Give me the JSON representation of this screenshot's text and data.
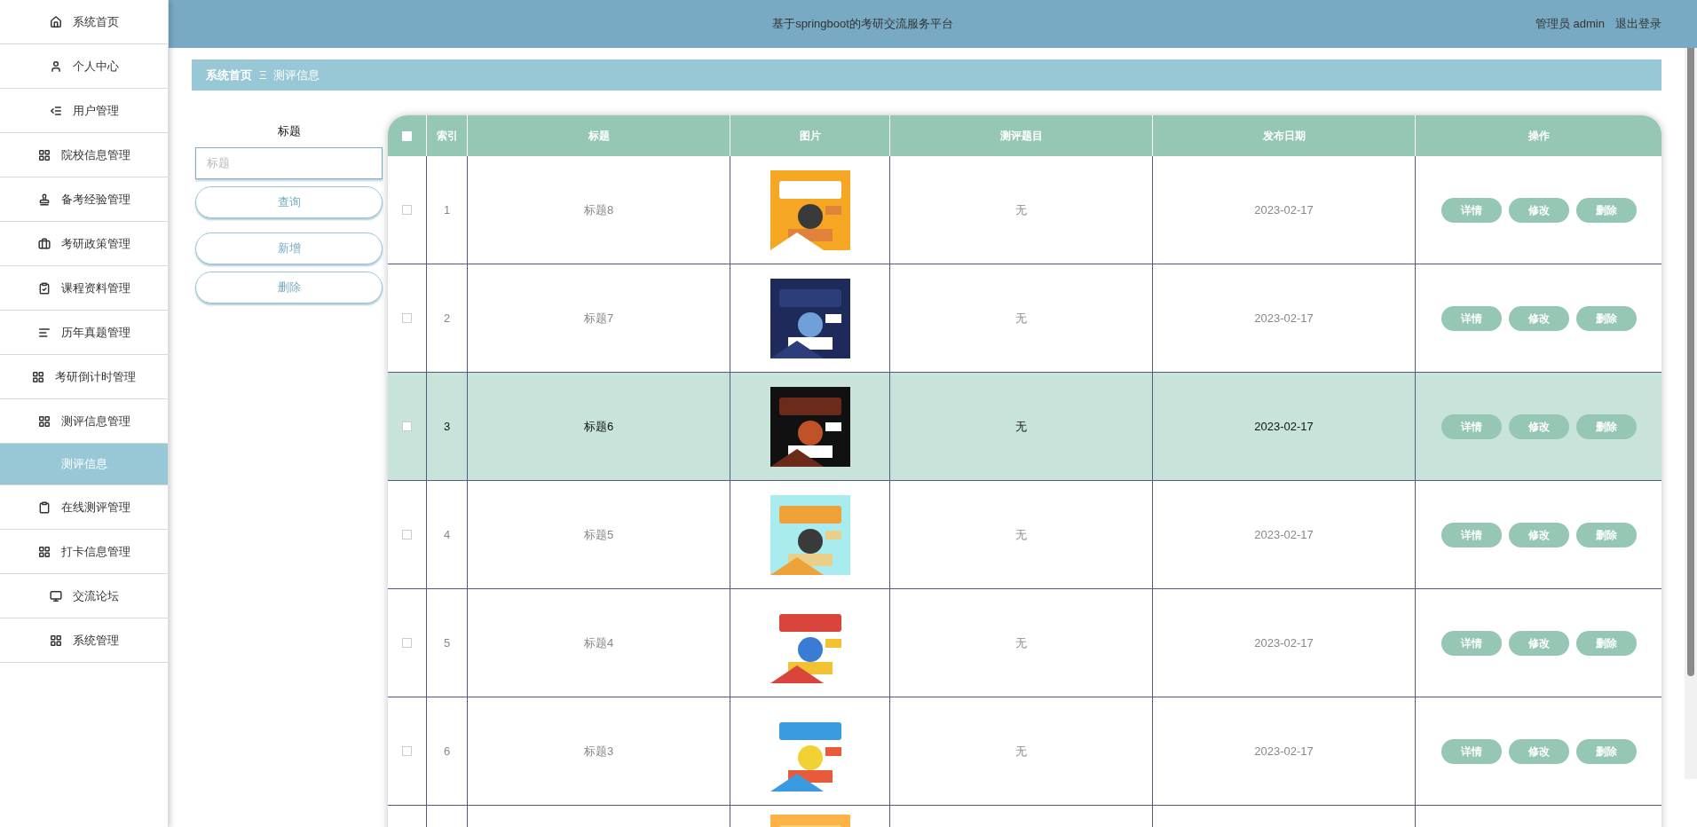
{
  "sidebar": {
    "items": [
      {
        "label": "系统首页",
        "selected": false
      },
      {
        "label": "个人中心",
        "selected": false
      },
      {
        "label": "用户管理",
        "selected": false
      },
      {
        "label": "院校信息管理",
        "selected": false
      },
      {
        "label": "备考经验管理",
        "selected": false
      },
      {
        "label": "考研政策管理",
        "selected": false
      },
      {
        "label": "课程资料管理",
        "selected": false
      },
      {
        "label": "历年真题管理",
        "selected": false
      },
      {
        "label": "考研倒计时管理",
        "selected": false
      },
      {
        "label": "测评信息管理",
        "selected": false,
        "expanded": true,
        "children": [
          {
            "label": "测评信息",
            "selected": true
          }
        ]
      },
      {
        "label": "在线测评管理",
        "selected": false
      },
      {
        "label": "打卡信息管理",
        "selected": false
      },
      {
        "label": "交流论坛",
        "selected": false
      },
      {
        "label": "系统管理",
        "selected": false
      }
    ]
  },
  "header": {
    "title": "基于springboot的考研交流服务平台",
    "user": "管理员 admin",
    "logout": "退出登录"
  },
  "breadcrumb": {
    "home": "系统首页",
    "separator": "Ξ",
    "current": "测评信息"
  },
  "filter": {
    "label": "标题",
    "placeholder": "标题",
    "buttons": [
      "查询",
      "新增",
      "删除"
    ]
  },
  "table": {
    "columns": [
      "索引",
      "标题",
      "图片",
      "测评题目",
      "发布日期",
      "操作"
    ],
    "all_checked": false,
    "rows": [
      {
        "index": "1",
        "title": "标题8",
        "question": "无",
        "date": "2023-02-17",
        "checked": false,
        "selected": false,
        "actions": [
          "详情",
          "修改",
          "删除"
        ]
      },
      {
        "index": "2",
        "title": "标题7",
        "question": "无",
        "date": "2023-02-17",
        "checked": false,
        "selected": false,
        "actions": [
          "详情",
          "修改",
          "删除"
        ]
      },
      {
        "index": "3",
        "title": "标题6",
        "question": "无",
        "date": "2023-02-17",
        "checked": false,
        "selected": true,
        "actions": [
          "详情",
          "修改",
          "删除"
        ]
      },
      {
        "index": "4",
        "title": "标题5",
        "question": "无",
        "date": "2023-02-17",
        "checked": false,
        "selected": false,
        "actions": [
          "详情",
          "修改",
          "删除"
        ]
      },
      {
        "index": "5",
        "title": "标题4",
        "question": "无",
        "date": "2023-02-17",
        "checked": false,
        "selected": false,
        "actions": [
          "详情",
          "修改",
          "删除"
        ]
      },
      {
        "index": "6",
        "title": "标题3",
        "question": "无",
        "date": "2023-02-17",
        "checked": false,
        "selected": false,
        "actions": [
          "详情",
          "修改",
          "删除"
        ]
      },
      {
        "partial": true,
        "selected": false
      }
    ]
  }
}
